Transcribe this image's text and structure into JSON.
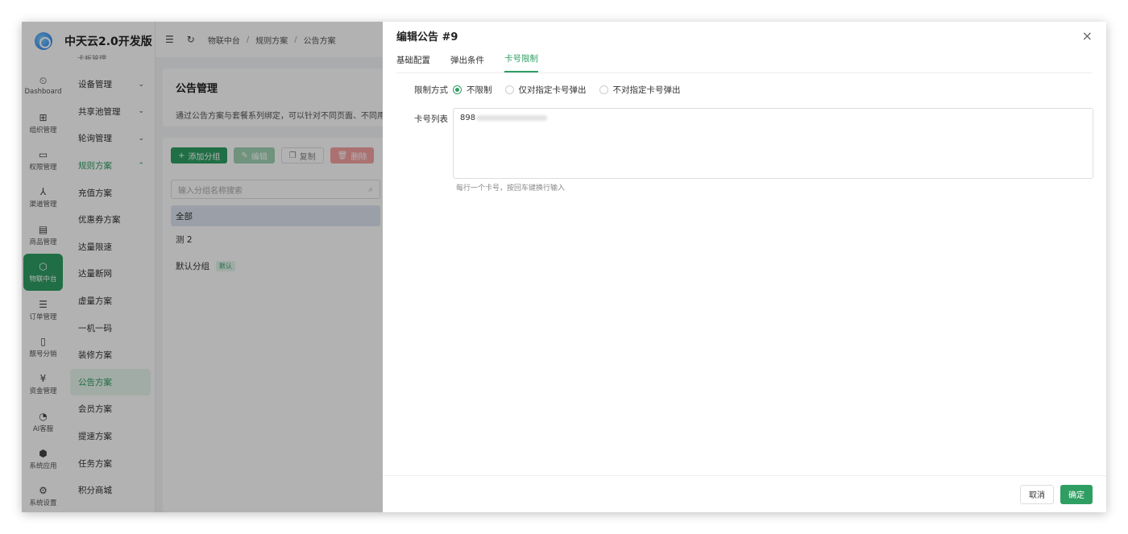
{
  "app": {
    "title": "中天云2.0开发版"
  },
  "rail": [
    {
      "icon": "⏲",
      "label": "Dashboard"
    },
    {
      "icon": "⊞",
      "label": "组织管理"
    },
    {
      "icon": "▭",
      "label": "权限管理"
    },
    {
      "icon": "⅄",
      "label": "渠道管理"
    },
    {
      "icon": "▤",
      "label": "商品管理"
    },
    {
      "icon": "⬡",
      "label": "物联中台"
    },
    {
      "icon": "☰",
      "label": "订单管理"
    },
    {
      "icon": "▯",
      "label": "靓号分销"
    },
    {
      "icon": "¥",
      "label": "资金管理"
    },
    {
      "icon": "◔",
      "label": "AI客服"
    },
    {
      "icon": "⬢",
      "label": "系统应用"
    },
    {
      "icon": "⚙",
      "label": "系统设置"
    }
  ],
  "menu": {
    "cut_label": "卡板管理",
    "items": [
      {
        "label": "设备管理",
        "chev": "⌄"
      },
      {
        "label": "共享池管理",
        "chev": "⌄"
      },
      {
        "label": "轮询管理",
        "chev": "⌄"
      },
      {
        "label": "规则方案",
        "chev": "⌃"
      },
      {
        "label": "充值方案"
      },
      {
        "label": "优惠券方案"
      },
      {
        "label": "达量限速"
      },
      {
        "label": "达量断网"
      },
      {
        "label": "虚量方案"
      },
      {
        "label": "一机一码"
      },
      {
        "label": "装修方案"
      },
      {
        "label": "公告方案"
      },
      {
        "label": "会员方案"
      },
      {
        "label": "提速方案"
      },
      {
        "label": "任务方案"
      },
      {
        "label": "积分商城"
      }
    ]
  },
  "topbar": {
    "menu_icon": "☰",
    "refresh_icon": "↻",
    "breadcrumbs": [
      "物联中台",
      "规则方案",
      "公告方案"
    ],
    "sep": "/"
  },
  "page": {
    "title": "公告管理",
    "desc": "通过公告方案与套餐系列绑定，可以针对不同页面、不同用户…",
    "buttons": {
      "add": "添加分组",
      "edit": "编辑",
      "copy": "复制",
      "delete": "删除"
    },
    "search_placeholder": "输入分组名称搜索",
    "groups": [
      {
        "name": "全部"
      },
      {
        "name": "测 2"
      },
      {
        "name": "默认分组",
        "tag": "默认"
      }
    ]
  },
  "drawer": {
    "title": "编辑公告 #9",
    "close": "×",
    "tabs": [
      "基础配置",
      "弹出条件",
      "卡号限制"
    ],
    "limit_label": "限制方式",
    "options": [
      "不限制",
      "仅对指定卡号弹出",
      "不对指定卡号弹出"
    ],
    "list_label": "卡号列表",
    "list_value": "898",
    "hint": "每行一个卡号，按回车键换行输入",
    "cancel": "取消",
    "confirm": "确定"
  }
}
